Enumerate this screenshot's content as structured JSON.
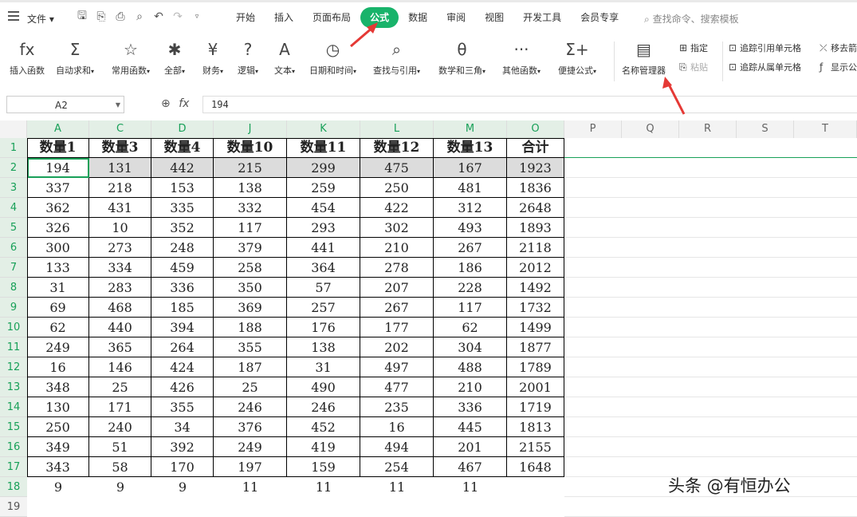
{
  "menu": {
    "file": "文件",
    "tabs": [
      "开始",
      "插入",
      "页面布局",
      "公式",
      "数据",
      "审阅",
      "视图",
      "开发工具",
      "会员专享"
    ],
    "active_tab_index": 3,
    "search_placeholder": "查找命令、搜索模板"
  },
  "ribbon": {
    "buttons": [
      {
        "label": "插入函数",
        "icon": "fx"
      },
      {
        "label": "自动求和",
        "icon": "Σ"
      },
      {
        "label": "常用函数",
        "icon": "☆"
      },
      {
        "label": "全部",
        "icon": "✱"
      },
      {
        "label": "财务",
        "icon": "¥"
      },
      {
        "label": "逻辑",
        "icon": "?"
      },
      {
        "label": "文本",
        "icon": "A"
      },
      {
        "label": "日期和时间",
        "icon": "◷"
      },
      {
        "label": "查找与引用",
        "icon": "⌕"
      },
      {
        "label": "数学和三角",
        "icon": "θ"
      },
      {
        "label": "其他函数",
        "icon": "···"
      },
      {
        "label": "便捷公式",
        "icon": "Σ+"
      },
      {
        "label": "名称管理器",
        "icon": "▤"
      }
    ],
    "small": {
      "define": "指定",
      "paste": "粘贴",
      "trace_precedents": "追踪引用单元格",
      "trace_dependents": "追踪从属单元格",
      "remove_arrows": "移去箭",
      "show_formulas": "显示公"
    }
  },
  "formula_bar": {
    "name_box": "A2",
    "fx": "fx",
    "value": "194"
  },
  "grid": {
    "columns": [
      "A",
      "C",
      "D",
      "J",
      "K",
      "L",
      "M",
      "O",
      "P",
      "Q",
      "R",
      "S",
      "T"
    ],
    "rows": [
      {
        "n": "1",
        "cells": [
          "数量1",
          "数量3",
          "数量4",
          "数量10",
          "数量11",
          "数量12",
          "数量13",
          "合计"
        ]
      },
      {
        "n": "2",
        "cells": [
          "194",
          "131",
          "442",
          "215",
          "299",
          "475",
          "167",
          "1923"
        ]
      },
      {
        "n": "3",
        "cells": [
          "337",
          "218",
          "153",
          "138",
          "259",
          "250",
          "481",
          "1836"
        ]
      },
      {
        "n": "4",
        "cells": [
          "362",
          "431",
          "335",
          "332",
          "454",
          "422",
          "312",
          "2648"
        ]
      },
      {
        "n": "5",
        "cells": [
          "326",
          "10",
          "352",
          "117",
          "293",
          "302",
          "493",
          "1893"
        ]
      },
      {
        "n": "6",
        "cells": [
          "300",
          "273",
          "248",
          "379",
          "441",
          "210",
          "267",
          "2118"
        ]
      },
      {
        "n": "7",
        "cells": [
          "133",
          "334",
          "459",
          "258",
          "364",
          "278",
          "186",
          "2012"
        ]
      },
      {
        "n": "8",
        "cells": [
          "31",
          "283",
          "336",
          "350",
          "57",
          "207",
          "228",
          "1492"
        ]
      },
      {
        "n": "9",
        "cells": [
          "69",
          "468",
          "185",
          "369",
          "257",
          "267",
          "117",
          "1732"
        ]
      },
      {
        "n": "10",
        "cells": [
          "62",
          "440",
          "394",
          "188",
          "176",
          "177",
          "62",
          "1499"
        ]
      },
      {
        "n": "11",
        "cells": [
          "249",
          "365",
          "264",
          "355",
          "138",
          "202",
          "304",
          "1877"
        ]
      },
      {
        "n": "12",
        "cells": [
          "16",
          "146",
          "424",
          "187",
          "31",
          "497",
          "488",
          "1789"
        ]
      },
      {
        "n": "13",
        "cells": [
          "348",
          "25",
          "426",
          "25",
          "490",
          "477",
          "210",
          "2001"
        ]
      },
      {
        "n": "14",
        "cells": [
          "130",
          "171",
          "355",
          "246",
          "246",
          "235",
          "336",
          "1719"
        ]
      },
      {
        "n": "15",
        "cells": [
          "250",
          "240",
          "34",
          "376",
          "452",
          "16",
          "445",
          "1813"
        ]
      },
      {
        "n": "16",
        "cells": [
          "349",
          "51",
          "392",
          "249",
          "419",
          "494",
          "201",
          "2155"
        ]
      },
      {
        "n": "17",
        "cells": [
          "343",
          "58",
          "170",
          "197",
          "159",
          "254",
          "467",
          "1648"
        ]
      },
      {
        "n": "18",
        "cells": [
          "9",
          "9",
          "9",
          "11",
          "11",
          "11",
          "11",
          ""
        ]
      },
      {
        "n": "19",
        "cells": [
          "",
          "",
          "",
          "",
          "",
          "",
          "",
          ""
        ]
      }
    ]
  },
  "watermark": "头条 @有恒办公",
  "colors": {
    "accent": "#18b36a",
    "arrow": "#e53935"
  }
}
